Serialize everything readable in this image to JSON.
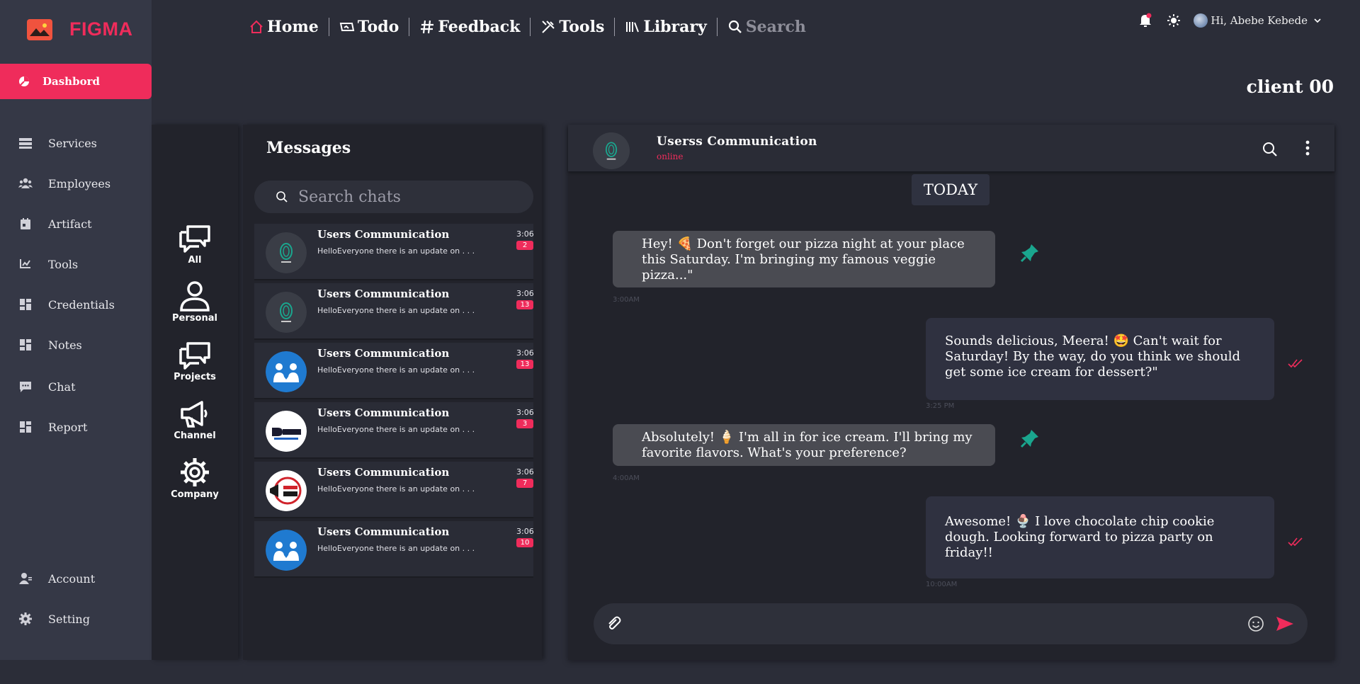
{
  "app": {
    "logo_text": "FIGMA"
  },
  "sidebar": {
    "active": {
      "label": "Dashbord"
    },
    "items": [
      {
        "label": "Services",
        "icon": "services-icon"
      },
      {
        "label": "Employees",
        "icon": "employees-icon"
      },
      {
        "label": "Artifact",
        "icon": "artifact-icon"
      },
      {
        "label": "Tools",
        "icon": "tools-icon"
      },
      {
        "label": "Credentials",
        "icon": "grid-icon"
      },
      {
        "label": "Notes",
        "icon": "grid-icon"
      },
      {
        "label": "Chat",
        "icon": "chat-icon"
      },
      {
        "label": "Report",
        "icon": "grid-icon"
      }
    ],
    "bottom": [
      {
        "label": "Account",
        "icon": "account-icon"
      },
      {
        "label": "Setting",
        "icon": "gear-icon"
      }
    ]
  },
  "topnav": {
    "home": "Home",
    "todo": "Todo",
    "feedback": "Feedback",
    "tools": "Tools",
    "library": "Library",
    "search": "Search",
    "greeting": "Hi, Abebe Kebede"
  },
  "page": {
    "title": "client 00"
  },
  "categories": [
    {
      "label": "All",
      "icon": "chats-icon"
    },
    {
      "label": "Personal",
      "icon": "person-icon"
    },
    {
      "label": "Projects",
      "icon": "chats-icon"
    },
    {
      "label": "Channel",
      "icon": "megaphone-icon"
    },
    {
      "label": "Company",
      "icon": "gear-icon"
    }
  ],
  "messages": {
    "title": "Messages",
    "search_placeholder": "Search chats",
    "chats": [
      {
        "name": "Users Communication",
        "preview": "HelloEveryone there is an update on . . .",
        "time": "3:06",
        "unread": "2",
        "avatar": "circle-logo"
      },
      {
        "name": "Users Communication",
        "preview": "HelloEveryone there is an update on . . .",
        "time": "3:06",
        "unread": "13",
        "avatar": "circle-logo"
      },
      {
        "name": "Users Communication",
        "preview": "HelloEveryone there is an update on . . .",
        "time": "3:06",
        "unread": "13",
        "avatar": "people-logo"
      },
      {
        "name": "Users Communication",
        "preview": "HelloEveryone there is an update on . . .",
        "time": "3:06",
        "unread": "3",
        "avatar": "daily-logo"
      },
      {
        "name": "Users Communication",
        "preview": "HelloEveryone there is an update on . . .",
        "time": "3:06",
        "unread": "7",
        "avatar": "latest-news-logo"
      },
      {
        "name": "Users Communication",
        "preview": "HelloEveryone there is an update on . . .",
        "time": "3:06",
        "unread": "10",
        "avatar": "people-logo"
      }
    ]
  },
  "chat": {
    "name": "Userss Communication",
    "status": "online",
    "day_label": "TODAY",
    "messages": [
      {
        "dir": "in",
        "text": "Hey! 🍕 Don't forget our pizza night at your place this Saturday. I'm bringing my famous veggie pizza...\"",
        "time": "3:00AM"
      },
      {
        "dir": "out",
        "text": "Sounds delicious, Meera! 🤩 Can't wait for Saturday! By the way, do you think we should get some ice cream for dessert?\"",
        "time": "3:25 PM"
      },
      {
        "dir": "in",
        "text": "Absolutely! 🍦 I'm all in for ice cream. I'll bring my favorite flavors. What's your preference?",
        "time": "4:00AM"
      },
      {
        "dir": "out",
        "text": "Awesome! 🍨 I love chocolate chip cookie dough. Looking forward to pizza party on friday!!",
        "time": "10:00AM"
      }
    ]
  },
  "colors": {
    "accent": "#ef2c5b",
    "pin": "#1aa68e",
    "sidebar": "#353846",
    "panel": "#22232b"
  }
}
